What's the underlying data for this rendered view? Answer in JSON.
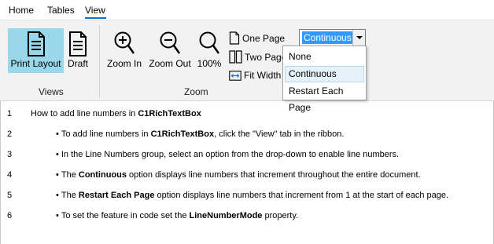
{
  "tabs": [
    {
      "label": "Home"
    },
    {
      "label": "Tables"
    },
    {
      "label": "View"
    }
  ],
  "active_tab": "View",
  "ribbon": {
    "views_group": {
      "label": "Views",
      "buttons": [
        {
          "label": "Print Layout",
          "icon": "document-icon",
          "selected": true
        },
        {
          "label": "Draft",
          "icon": "document-icon",
          "selected": false
        }
      ]
    },
    "zoom_group": {
      "label": "Zoom",
      "buttons": [
        {
          "label": "Zoom In",
          "icon": "zoom-in-icon"
        },
        {
          "label": "Zoom Out",
          "icon": "zoom-out-icon"
        },
        {
          "label": "100%",
          "icon": "magnifier-icon"
        }
      ],
      "small_buttons": [
        {
          "label": "One Page",
          "icon": "one-page-icon"
        },
        {
          "label": "Two Pages",
          "icon": "two-pages-icon"
        },
        {
          "label": "Fit Width",
          "icon": "fit-width-icon"
        }
      ]
    },
    "line_numbers": {
      "selected": "Continuous",
      "options": [
        "None",
        "Continuous",
        "Restart Each Page"
      ],
      "highlighted": "Continuous"
    }
  },
  "document": {
    "lines": [
      {
        "number": "1",
        "bullet": "",
        "parts": [
          {
            "text": "How to add line numbers in ",
            "bold": false
          },
          {
            "text": "C1RichTextBox",
            "bold": true
          }
        ]
      },
      {
        "number": "2",
        "bullet": "•",
        "parts": [
          {
            "text": "To add line numbers in ",
            "bold": false
          },
          {
            "text": "C1RichTextBox",
            "bold": true
          },
          {
            "text": ", click the \"View\" tab in the ribbon.",
            "bold": false
          }
        ]
      },
      {
        "number": "3",
        "bullet": "•",
        "parts": [
          {
            "text": "In the Line Numbers group, select an option from the drop-down to enable line numbers.",
            "bold": false
          }
        ]
      },
      {
        "number": "4",
        "bullet": "•",
        "parts": [
          {
            "text": "The ",
            "bold": false
          },
          {
            "text": "Continuous",
            "bold": true
          },
          {
            "text": " option displays line numbers that increment throughout the entire document.",
            "bold": false
          }
        ]
      },
      {
        "number": "5",
        "bullet": "•",
        "parts": [
          {
            "text": "The ",
            "bold": false
          },
          {
            "text": "Restart Each Page",
            "bold": true
          },
          {
            "text": " option displays line numbers that increment from 1 at the start of each page.",
            "bold": false
          }
        ]
      },
      {
        "number": "6",
        "bullet": "•",
        "parts": [
          {
            "text": "To set the feature in code set the ",
            "bold": false
          },
          {
            "text": "LineNumberMode",
            "bold": true
          },
          {
            "text": " property.",
            "bold": false
          }
        ]
      }
    ]
  },
  "colors": {
    "accent": "#1e6fc4",
    "selected_button": "#99d8ea",
    "ribbon_background": "#f2f2f2",
    "combo_selection": "#3399ff"
  }
}
